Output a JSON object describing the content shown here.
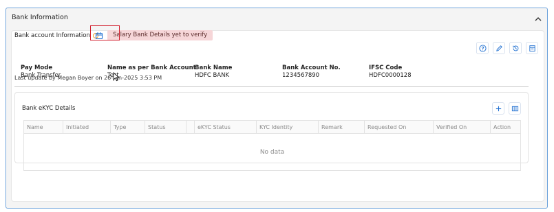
{
  "section": {
    "title": "Bank Information"
  },
  "bank": {
    "label": "Bank account Information",
    "tooltip": "Salary Bank Details yet to verify",
    "fields": [
      {
        "label": "Pay Mode",
        "value": "Bank Transfer"
      },
      {
        "label": "Name as per Bank Account",
        "value": "Test"
      },
      {
        "label": "Bank Name",
        "value": "HDFC BANK"
      },
      {
        "label": "Bank Account No.",
        "value": "1234567890"
      },
      {
        "label": "IFSC Code",
        "value": "HDFC0000128"
      }
    ],
    "last_update": "Last update by Megan Boyer on 26-Jun-2025 3:53 PM"
  },
  "ekyc": {
    "title": "Bank eKYC Details",
    "columns": [
      "Name",
      "Initiated",
      "Type",
      "Status",
      "",
      "eKYC Status",
      "KYC Identity",
      "Remark",
      "Requested On",
      "Verified On",
      "Action"
    ],
    "empty_text": "No data"
  },
  "colors": {
    "accent": "#1f6fd1",
    "border_blue": "#6fa4dc",
    "tooltip_bg": "#f6d6d8",
    "highlight": "#d2202f"
  }
}
